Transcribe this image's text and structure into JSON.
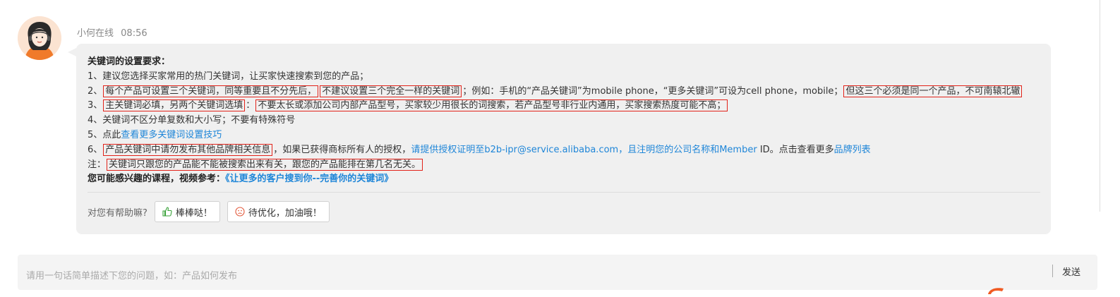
{
  "agent": {
    "name": "小何在线",
    "time": "08:56"
  },
  "message": {
    "title": "关键词的设置要求：",
    "line1": "1、建议您选择买家常用的热门关键词，让买家快速搜索到您的产品；",
    "line2": {
      "prefix": "2、",
      "hl1": "每个产品可设置三个关键词，同等重要且不分先后，",
      "hl2": "不建议设置三个完全一样的关键词",
      "mid": "；例如：手机的“产品关键词”为mobile phone，“更多关键词”可设为cell phone，mobile；",
      "hl3": "但这三个必须是同一个产品，不可南辕北辙"
    },
    "line3": {
      "prefix": "3、",
      "hl1": "主关键词必填，另两个关键词选填",
      "colon": "：",
      "hl2": "不要太长或添加公司内部产品型号，买家较少用很长的词搜索，若产品型号非行业内通用，买家搜索热度可能不高；"
    },
    "line4": "4、关键词不区分单复数和大小写；不要有特殊符号",
    "line5": {
      "prefix": "5、点此",
      "link": "查看更多关键词设置技巧"
    },
    "line6": {
      "prefix": "6、",
      "hl1": "产品关键词中请勿发布其他品牌相关信息",
      "mid": "，如果已获得商标所有人的授权，",
      "link1": "请提供授权证明至b2b-ipr@service.alibaba.com，且注明您的公司名称和Member",
      "mid2": " ID。点击查看更多",
      "link2": "品牌列表"
    },
    "note": {
      "prefix": "注：",
      "hl1": "关键词只跟您的产品能不能被搜索出来有关，跟您的产品能排在第几名无关。"
    },
    "course": {
      "label": "您可能感兴趣的课程，视频参考：",
      "link": "《让更多的客户搜到你--完善你的关键词》"
    }
  },
  "feedback": {
    "question": "对您有帮助嘛?",
    "good_label": "棒棒哒！",
    "bad_label": "待优化，加油哦！"
  },
  "composer": {
    "placeholder": "请用一句话简单描述下您的问题，如：产品如何发布",
    "send_label": "发送"
  },
  "colors": {
    "highlight": "#e2231a",
    "link": "#1f86d8",
    "bubble": "#f0f0f0"
  }
}
